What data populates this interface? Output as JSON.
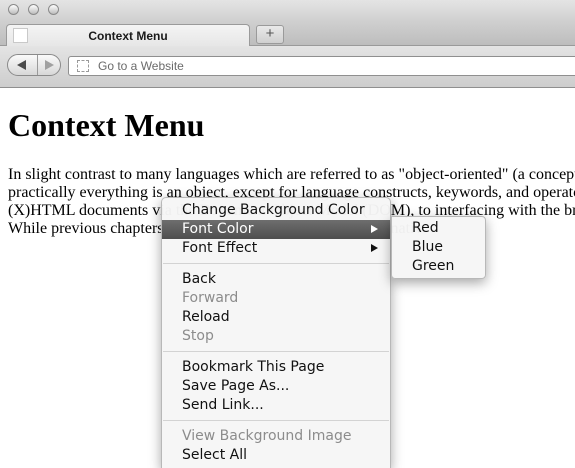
{
  "browser": {
    "tab_title": "Context Menu",
    "new_tab_label": "+",
    "url_placeholder": "Go to a Website"
  },
  "page": {
    "heading": "Context Menu",
    "paragraph_lines": [
      "In slight contrast to many languages which are referred to as \"object-oriented\" (a concept",
      "practically everything is an object, except for language constructs, keywords, and operato",
      "(X)HTML documents via the Document Object Model (DOM), to interfacing with the bro",
      "While previous chapters have only demonstrated the use of nativ"
    ]
  },
  "context_menu": {
    "group1": [
      {
        "label": "Change Background Color",
        "enabled": true
      },
      {
        "label": "Font Color",
        "enabled": true,
        "submenu": true,
        "highlighted": true
      },
      {
        "label": "Font Effect",
        "enabled": true,
        "submenu": true
      }
    ],
    "group2": [
      {
        "label": "Back",
        "enabled": true
      },
      {
        "label": "Forward",
        "enabled": false
      },
      {
        "label": "Reload",
        "enabled": true
      },
      {
        "label": "Stop",
        "enabled": false
      }
    ],
    "group3": [
      {
        "label": "Bookmark This Page",
        "enabled": true
      },
      {
        "label": "Save Page As...",
        "enabled": true
      },
      {
        "label": "Send Link...",
        "enabled": true
      }
    ],
    "group4": [
      {
        "label": "View Background Image",
        "enabled": false
      },
      {
        "label": "Select All",
        "enabled": true
      }
    ]
  },
  "font_color_submenu": [
    "Red",
    "Blue",
    "Green"
  ],
  "colors": {
    "highlight": "#5e5e5e",
    "disabled_text": "#8c8c8c"
  }
}
